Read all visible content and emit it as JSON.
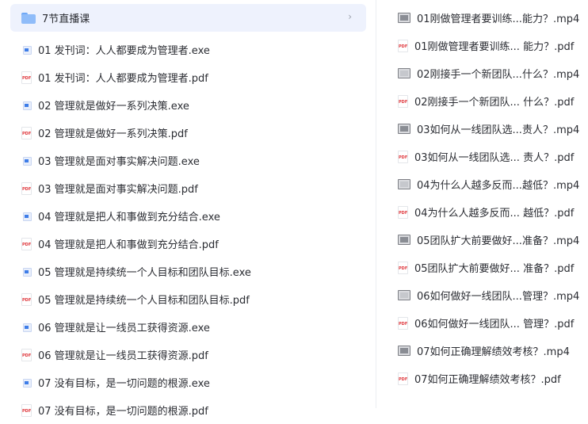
{
  "folder": {
    "name": "7节直播课",
    "icon": "folder-icon",
    "chevron": "›"
  },
  "left_files": [
    {
      "name": "01 发刊词：人人都要成为管理者.exe",
      "type": "exe"
    },
    {
      "name": "01 发刊词：人人都要成为管理者.pdf",
      "type": "pdf"
    },
    {
      "name": "02 管理就是做好一系列决策.exe",
      "type": "exe"
    },
    {
      "name": "02 管理就是做好一系列决策.pdf",
      "type": "pdf"
    },
    {
      "name": "03 管理就是面对事实解决问题.exe",
      "type": "exe"
    },
    {
      "name": "03 管理就是面对事实解决问题.pdf",
      "type": "pdf"
    },
    {
      "name": "04 管理就是把人和事做到充分结合.exe",
      "type": "exe"
    },
    {
      "name": "04 管理就是把人和事做到充分结合.pdf",
      "type": "pdf"
    },
    {
      "name": "05 管理就是持续统一个人目标和团队目标.exe",
      "type": "exe"
    },
    {
      "name": "05 管理就是持续统一个人目标和团队目标.pdf",
      "type": "pdf"
    },
    {
      "name": "06 管理就是让一线员工获得资源.exe",
      "type": "exe"
    },
    {
      "name": "06 管理就是让一线员工获得资源.pdf",
      "type": "pdf"
    },
    {
      "name": "07 没有目标，是一切问题的根源.exe",
      "type": "exe"
    },
    {
      "name": "07 没有目标，是一切问题的根源.pdf",
      "type": "pdf"
    }
  ],
  "right_files": [
    {
      "name": "01刚做管理者要训练...能力？.mp4",
      "type": "mp4"
    },
    {
      "name": "01刚做管理者要训练... 能力？.pdf",
      "type": "pdf"
    },
    {
      "name": "02刚接手一个新团队...什么？.mp4",
      "type": "mp4"
    },
    {
      "name": "02刚接手一个新团队... 什么？.pdf",
      "type": "pdf"
    },
    {
      "name": "03如何从一线团队选...责人？.mp4",
      "type": "mp4"
    },
    {
      "name": "03如何从一线团队选... 责人？.pdf",
      "type": "pdf"
    },
    {
      "name": "04为什么人越多反而...越低？.mp4",
      "type": "mp4"
    },
    {
      "name": "04为什么人越多反而... 越低？.pdf",
      "type": "pdf"
    },
    {
      "name": "05团队扩大前要做好...准备？.mp4",
      "type": "mp4"
    },
    {
      "name": "05团队扩大前要做好... 准备？.pdf",
      "type": "pdf"
    },
    {
      "name": "06如何做好一线团队...管理？.mp4",
      "type": "mp4"
    },
    {
      "name": "06如何做好一线团队... 管理？.pdf",
      "type": "pdf"
    },
    {
      "name": "07如何正确理解绩效考核？.mp4",
      "type": "mp4"
    },
    {
      "name": "07如何正确理解绩效考核？.pdf",
      "type": "pdf"
    }
  ],
  "icon_names": {
    "exe": "exe-file-icon",
    "pdf": "pdf-file-icon",
    "mp4": "video-file-icon"
  },
  "pdf_icon_text": "PDF",
  "colors": {
    "folder_row_bg": "#eef2fd",
    "folder_icon": "#8fbcf9",
    "pdf_red": "#e0393e",
    "exe_blue": "#3e7de8",
    "text": "#2b2d33"
  }
}
